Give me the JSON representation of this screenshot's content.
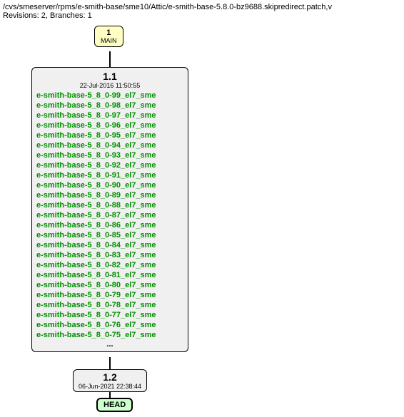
{
  "header": {
    "path": "/cvs/smeserver/rpms/e-smith-base/sme10/Attic/e-smith-base-5.8.0-bz9688.skipredirect.patch,v",
    "revisions_line": "Revisions: 2, Branches: 1"
  },
  "main_branch": {
    "number": "1",
    "label": "MAIN"
  },
  "rev1": {
    "number": "1.1",
    "date": "22-Jul-2016 11:50:55",
    "tags": [
      "e-smith-base-5_8_0-99_el7_sme",
      "e-smith-base-5_8_0-98_el7_sme",
      "e-smith-base-5_8_0-97_el7_sme",
      "e-smith-base-5_8_0-96_el7_sme",
      "e-smith-base-5_8_0-95_el7_sme",
      "e-smith-base-5_8_0-94_el7_sme",
      "e-smith-base-5_8_0-93_el7_sme",
      "e-smith-base-5_8_0-92_el7_sme",
      "e-smith-base-5_8_0-91_el7_sme",
      "e-smith-base-5_8_0-90_el7_sme",
      "e-smith-base-5_8_0-89_el7_sme",
      "e-smith-base-5_8_0-88_el7_sme",
      "e-smith-base-5_8_0-87_el7_sme",
      "e-smith-base-5_8_0-86_el7_sme",
      "e-smith-base-5_8_0-85_el7_sme",
      "e-smith-base-5_8_0-84_el7_sme",
      "e-smith-base-5_8_0-83_el7_sme",
      "e-smith-base-5_8_0-82_el7_sme",
      "e-smith-base-5_8_0-81_el7_sme",
      "e-smith-base-5_8_0-80_el7_sme",
      "e-smith-base-5_8_0-79_el7_sme",
      "e-smith-base-5_8_0-78_el7_sme",
      "e-smith-base-5_8_0-77_el7_sme",
      "e-smith-base-5_8_0-76_el7_sme",
      "e-smith-base-5_8_0-75_el7_sme"
    ],
    "ellipsis": "..."
  },
  "rev2": {
    "number": "1.2",
    "date": "06-Jun-2021 22:38:44"
  },
  "head": {
    "label": "HEAD"
  }
}
